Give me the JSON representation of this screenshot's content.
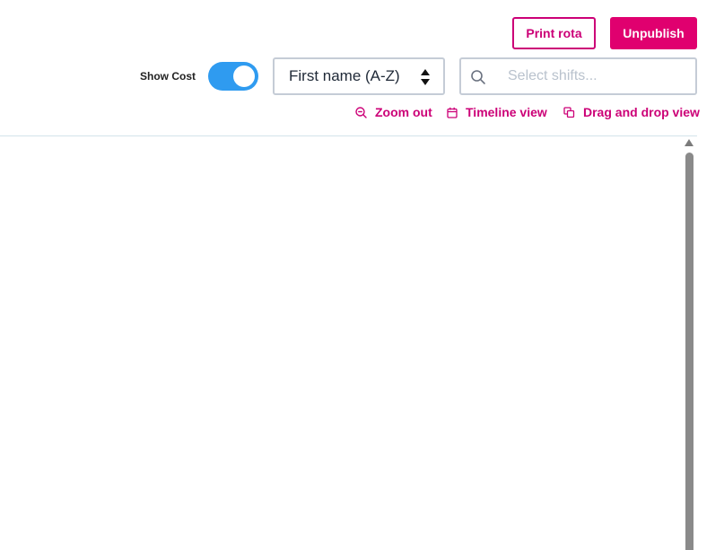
{
  "actions": {
    "print_label": "Print rota",
    "unpublish_label": "Unpublish"
  },
  "controls": {
    "show_cost_label": "Show Cost",
    "show_cost_enabled": true,
    "sort_value": "First name (A-Z)",
    "search_placeholder": "Select shifts...",
    "search_value": ""
  },
  "links": {
    "zoom_out": "Zoom out",
    "timeline_view": "Timeline view",
    "drag_and_drop_view": "Drag and drop view"
  },
  "icons": {
    "zoom": "zoom-out-icon",
    "timeline": "calendar-icon",
    "drag": "layers-icon",
    "search": "search-icon",
    "sort": "sort-arrows-icon"
  },
  "colors": {
    "accent": "#e0006f",
    "accent_text": "#cc0077",
    "toggle_on": "#2f9bf0",
    "border": "#c5ccd6",
    "placeholder": "#b9c2cd"
  }
}
